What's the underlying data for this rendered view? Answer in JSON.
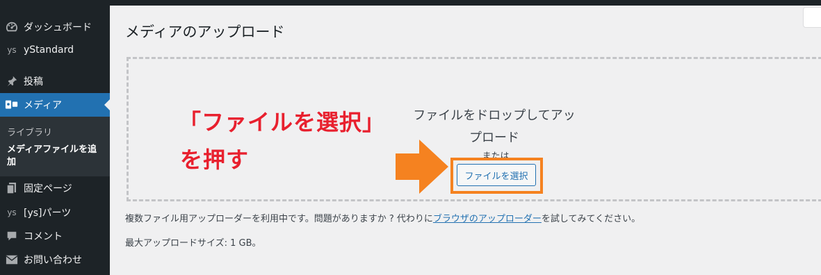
{
  "sidebar": {
    "items": [
      {
        "label": "ダッシュボード",
        "icon": "dashboard-icon"
      },
      {
        "label": "yStandard",
        "icon": "ys-icon",
        "icon_text": "ys"
      },
      {
        "label": "投稿",
        "icon": "pin-icon"
      },
      {
        "label": "メディア",
        "icon": "media-icon"
      },
      {
        "label": "固定ページ",
        "icon": "page-icon"
      },
      {
        "label": "[ys]パーツ",
        "icon": "ys-icon",
        "icon_text": "ys"
      },
      {
        "label": "コメント",
        "icon": "comment-icon"
      },
      {
        "label": "お問い合わせ",
        "icon": "mail-icon"
      }
    ],
    "submenu": {
      "library": "ライブラリ",
      "add_new": "メディアファイルを追加"
    }
  },
  "main": {
    "title": "メディアのアップロード",
    "dropzone": {
      "drop_text": "ファイルをドロップしてアップロード",
      "or_text": "または",
      "select_button": "ファイルを選択"
    },
    "annotation": {
      "line1": "「ファイルを選択」",
      "line2": "を押す"
    },
    "info": {
      "multi_uploader_before": "複数ファイル用アップローダーを利用中です。問題がありますか ? 代わりに",
      "browser_uploader_link": "ブラウザのアップローダー",
      "multi_uploader_after": "を試してみてください。",
      "max_size": "最大アップロードサイズ: 1 GB。"
    }
  },
  "colors": {
    "sidebar_bg": "#1d2327",
    "active": "#2271b1",
    "annotation_text": "#e8202e",
    "highlight": "#f58220"
  }
}
